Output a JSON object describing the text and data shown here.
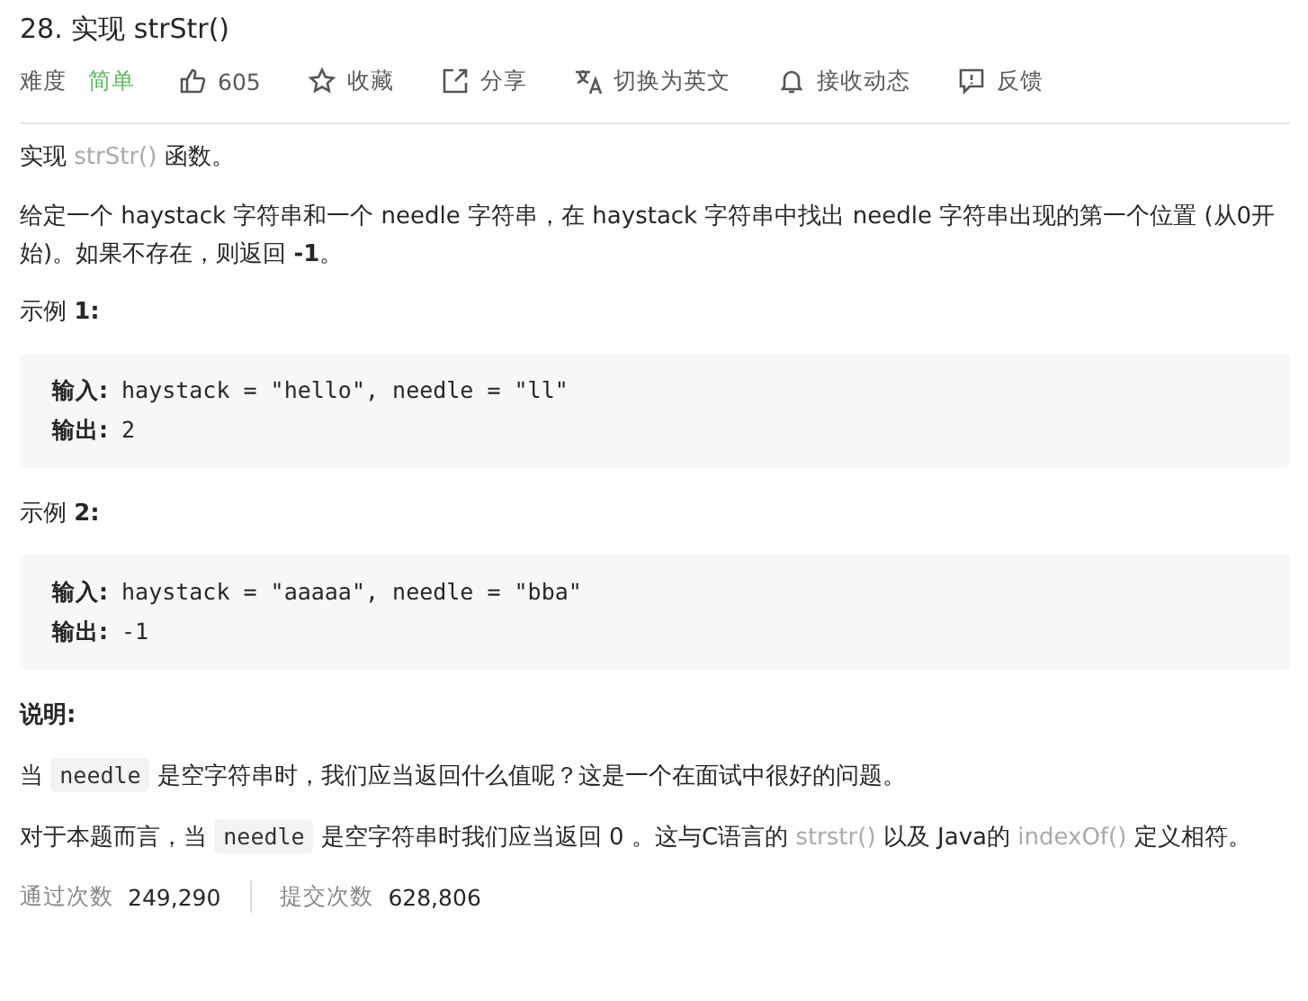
{
  "title": "28. 实现 strStr()",
  "toolbar": {
    "difficulty_label": "难度",
    "difficulty": "简单",
    "items": [
      {
        "kind": "like",
        "label": "605"
      },
      {
        "kind": "star",
        "label": "收藏"
      },
      {
        "kind": "share",
        "label": "分享"
      },
      {
        "kind": "translate",
        "label": "切换为英文"
      },
      {
        "kind": "bell",
        "label": "接收动态"
      },
      {
        "kind": "feedback",
        "label": "反馈"
      }
    ]
  },
  "content": [
    {
      "kind": "para",
      "parts": [
        {
          "kind": "text",
          "text": "实现 "
        },
        {
          "kind": "link",
          "text": "strStr()"
        },
        {
          "kind": "text",
          "text": " 函数。"
        }
      ]
    },
    {
      "kind": "para",
      "parts": [
        {
          "kind": "text",
          "text": "给定一个 haystack 字符串和一个 needle 字符串，在 haystack 字符串中找出 needle 字符串出现的第一个位置 (从0开始)。如果不存在，则返回  **-1**。"
        }
      ]
    },
    {
      "kind": "heading",
      "text": "示例 **1:**"
    },
    {
      "kind": "code",
      "lines": [
        {
          "label": "输入:",
          "value": "haystack = \"hello\", needle = \"ll\""
        },
        {
          "label": "输出:",
          "value": "2"
        }
      ]
    },
    {
      "kind": "heading",
      "text": "示例 **2:**"
    },
    {
      "kind": "code",
      "lines": [
        {
          "label": "输入:",
          "value": "haystack = \"aaaaa\", needle = \"bba\""
        },
        {
          "label": "输出:",
          "value": "-1"
        }
      ]
    },
    {
      "kind": "heading",
      "text": "**说明:**"
    },
    {
      "kind": "para",
      "parts": [
        {
          "kind": "text",
          "text": "当 "
        },
        {
          "kind": "code",
          "text": "needle"
        },
        {
          "kind": "text",
          "text": " 是空字符串时，我们应当返回什么值呢？这是一个在面试中很好的问题。"
        }
      ]
    },
    {
      "kind": "para",
      "parts": [
        {
          "kind": "text",
          "text": "对于本题而言，当 "
        },
        {
          "kind": "code",
          "text": "needle"
        },
        {
          "kind": "text",
          "text": " 是空字符串时我们应当返回 0 。这与C语言的 "
        },
        {
          "kind": "link",
          "text": "strstr()"
        },
        {
          "kind": "text",
          "text": " 以及 Java的 "
        },
        {
          "kind": "link",
          "text": "indexOf()"
        },
        {
          "kind": "text",
          "text": " 定义相符。"
        }
      ]
    }
  ],
  "stats": [
    {
      "label": "通过次数",
      "value": "249,290"
    },
    {
      "label": "提交次数",
      "value": "628,806"
    }
  ]
}
